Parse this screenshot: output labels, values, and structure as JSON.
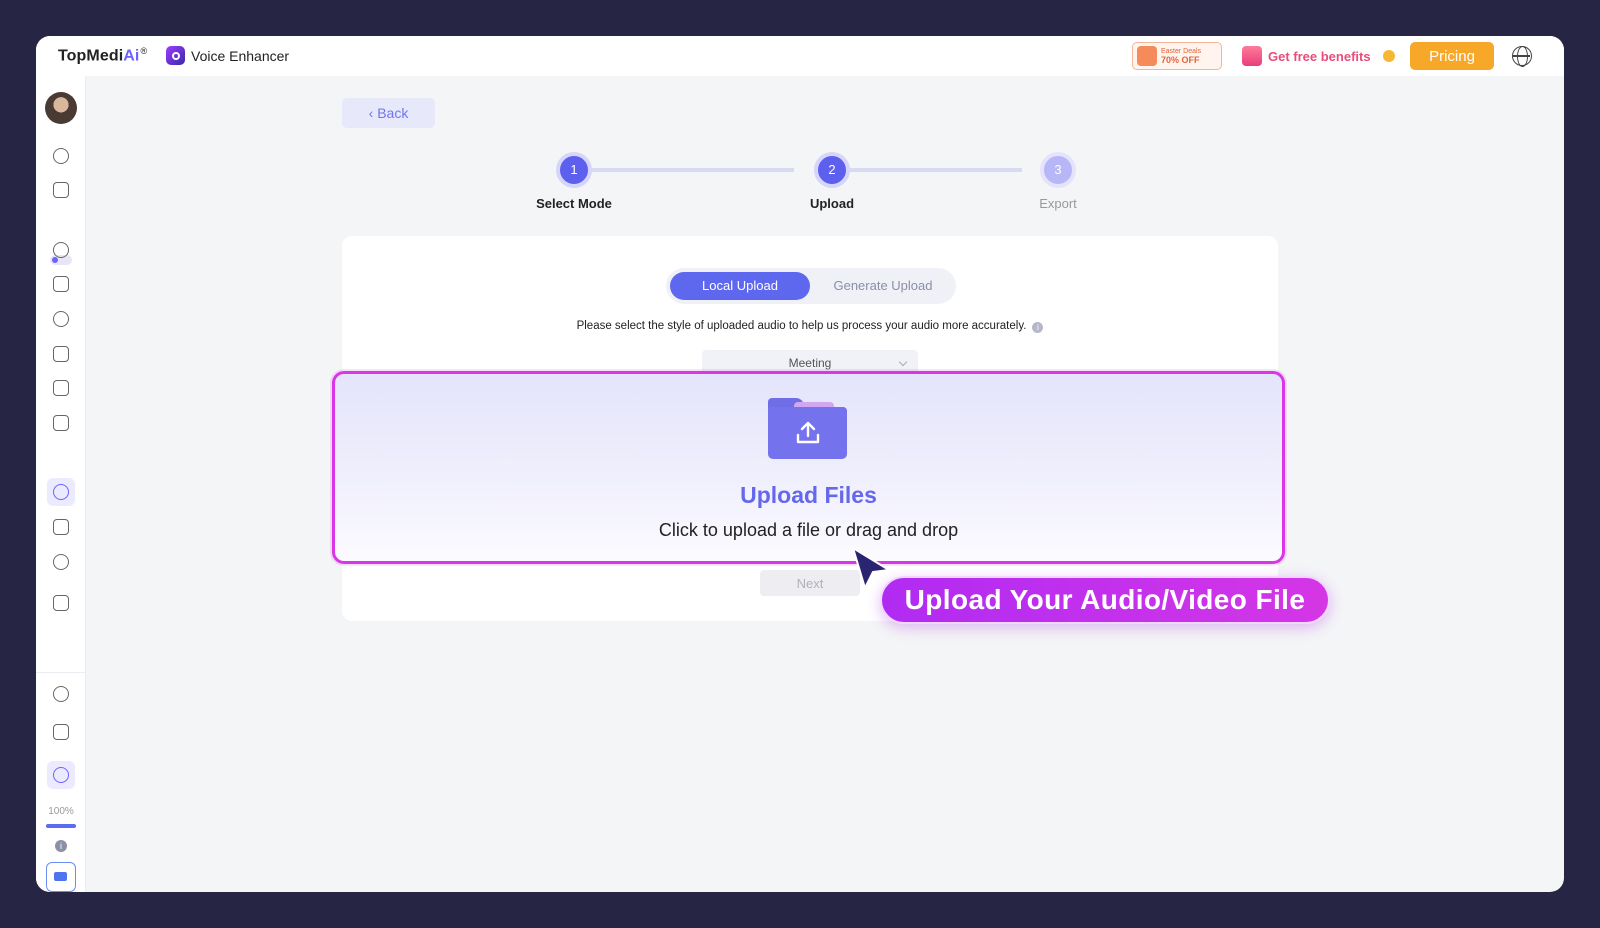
{
  "header": {
    "brand_name": "TopMedi",
    "brand_ai": "Ai",
    "brand_mark": "®",
    "app_name": "Voice Enhancer",
    "deal_line1": "Easter Deals",
    "deal_line2": "70% OFF",
    "benefits_label": "Get free benefits",
    "pricing_label": "Pricing"
  },
  "sidebar": {
    "zoom_percent_label": "100%",
    "zoom_fraction": 1.0,
    "info_glyph": "i",
    "icons": [
      "eraser-icon",
      "folder-icon",
      "toggle-icon",
      "voice-changer-icon",
      "video-icon",
      "audio-icon",
      "text-image-icon",
      "pen-icon",
      "document-icon",
      "microphone-icon",
      "speaker-icon",
      "globe-icon",
      "toolbox-icon",
      "chat-icon",
      "apps-icon",
      "microphone-icon",
      "credit-card-icon"
    ]
  },
  "main": {
    "back_label": "Back",
    "steps": [
      {
        "number": "1",
        "label": "Select Mode",
        "state": "done"
      },
      {
        "number": "2",
        "label": "Upload",
        "state": "active"
      },
      {
        "number": "3",
        "label": "Export",
        "state": "pending"
      }
    ],
    "tabs": [
      {
        "label": "Local Upload",
        "active": true
      },
      {
        "label": "Generate Upload",
        "active": false
      }
    ],
    "hint_text": "Please select the style of uploaded audio to help us process your audio more accurately.",
    "hint_glyph": "i",
    "mode_selected": "Meeting",
    "next_label": "Next"
  },
  "upload": {
    "title": "Upload Files",
    "subtitle": "Click to upload a file or drag and drop"
  },
  "callout": {
    "text": "Upload Your Audio/Video File"
  },
  "colors": {
    "accent": "#5d68ef",
    "highlight_border": "#d936e8",
    "callout": "#c031ee",
    "pricing": "#f7a829",
    "frame": "#272544"
  }
}
